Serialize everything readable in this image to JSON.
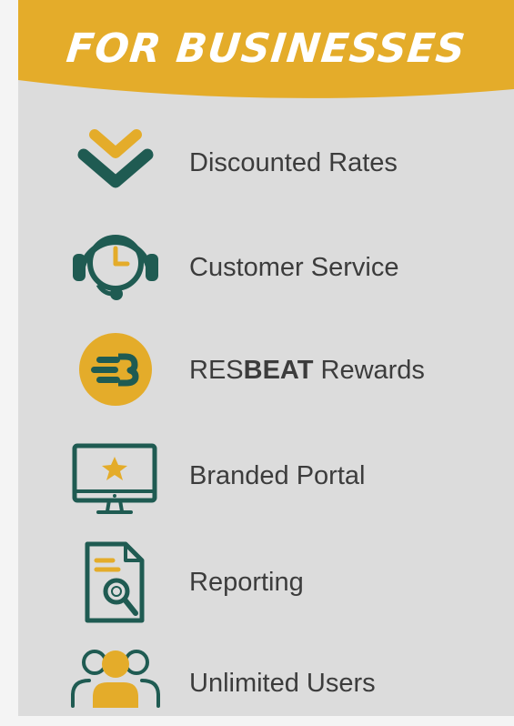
{
  "banner": {
    "title": "For Businesses"
  },
  "items": [
    {
      "label": "Discounted Rates",
      "icon": "double-chevron-down-icon"
    },
    {
      "label": "Customer Service",
      "icon": "headset-clock-icon"
    },
    {
      "label_prefix": "RES",
      "label_bold": "BEAT",
      "label_suffix": " Rewards",
      "icon": "resbeat-logo-icon"
    },
    {
      "label": "Branded Portal",
      "icon": "monitor-star-icon"
    },
    {
      "label": "Reporting",
      "icon": "document-magnifier-icon"
    },
    {
      "label": "Unlimited Users",
      "icon": "users-group-icon"
    }
  ],
  "colors": {
    "banner": "#e4ac2a",
    "teal": "#1f5b52",
    "gold": "#e4ac2a",
    "card": "#dcdcdc",
    "text": "#3c3c3c"
  }
}
